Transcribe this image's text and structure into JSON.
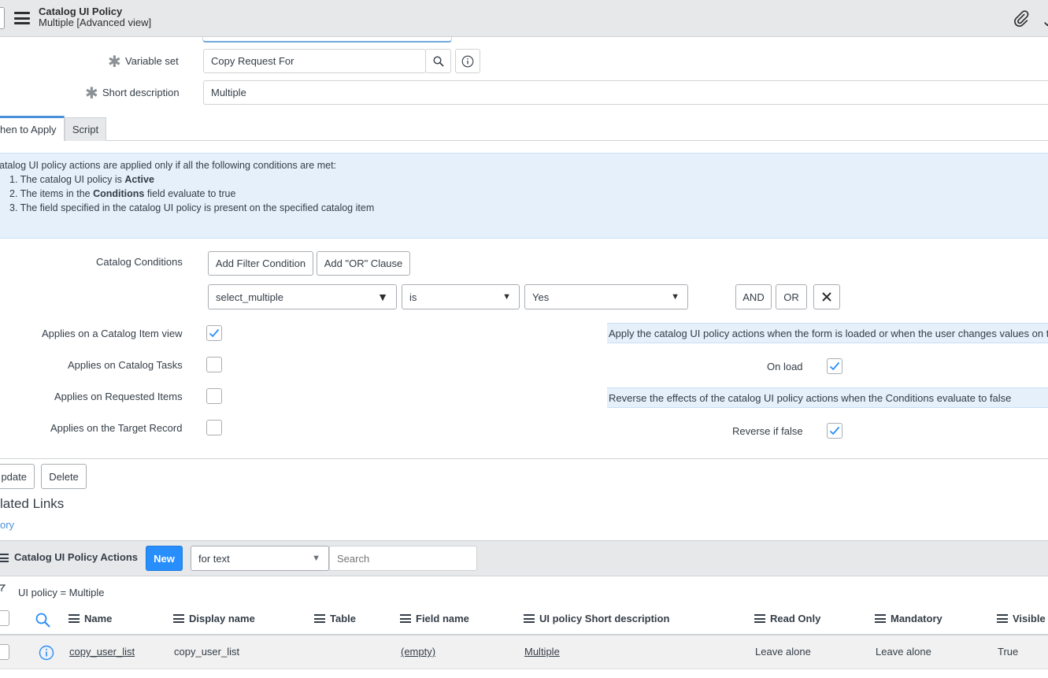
{
  "header": {
    "title": "Catalog UI Policy",
    "subtitle": "Multiple [Advanced view]"
  },
  "form": {
    "variable_set_label": "Variable set",
    "variable_set_value": "Copy Request For",
    "short_description_label": "Short description",
    "short_description_value": "Multiple"
  },
  "tabs": [
    {
      "label": "hen to Apply",
      "active": true
    },
    {
      "label": "Script",
      "active": false
    }
  ],
  "info": {
    "intro": "atalog UI policy actions are applied only if all the following conditions are met:",
    "item1_pre": "1. The catalog UI policy is ",
    "item1_bold": "Active",
    "item2_pre": "2. The items in the ",
    "item2_bold": "Conditions",
    "item2_post": " field evaluate to true",
    "item3": "3. The field specified in the catalog UI policy is present on the specified catalog item"
  },
  "conditions": {
    "label": "Catalog Conditions",
    "add_filter": "Add Filter Condition",
    "add_or": "Add \"OR\" Clause",
    "field": "select_multiple",
    "operator": "is",
    "value": "Yes",
    "and_label": "AND",
    "or_label": "OR"
  },
  "applies": {
    "catalog_item_view": {
      "label": "Applies on a Catalog Item view",
      "checked": true
    },
    "catalog_tasks": {
      "label": "Applies on Catalog Tasks",
      "checked": false
    },
    "requested_items": {
      "label": "Applies on Requested Items",
      "checked": false
    },
    "target_record": {
      "label": "Applies on the Target Record",
      "checked": false
    }
  },
  "right_panel": {
    "onload_hint": "Apply the catalog UI policy actions when the form is loaded or when the user changes values on t",
    "onload_label": "On load",
    "onload_checked": true,
    "reverse_hint": "Reverse the effects of the catalog UI policy actions when the Conditions evaluate to false",
    "reverse_label": "Reverse if false",
    "reverse_checked": true
  },
  "actions": {
    "update": "pdate",
    "delete": "Delete"
  },
  "related_links": {
    "title": "lated Links",
    "link": "ory"
  },
  "related_list": {
    "title": "Catalog UI Policy Actions",
    "new_label": "New",
    "filter_select": "for text",
    "search_placeholder": "Search",
    "breadcrumb": "UI policy = Multiple",
    "columns": [
      "Name",
      "Display name",
      "Table",
      "Field name",
      "UI policy Short description",
      "Read Only",
      "Mandatory",
      "Visible"
    ],
    "rows": [
      {
        "name": "copy_user_list",
        "display_name": "copy_user_list",
        "table": "",
        "field_name": "(empty)",
        "short_description": "Multiple",
        "read_only": "Leave alone",
        "mandatory": "Leave alone",
        "visible": "True"
      }
    ]
  }
}
